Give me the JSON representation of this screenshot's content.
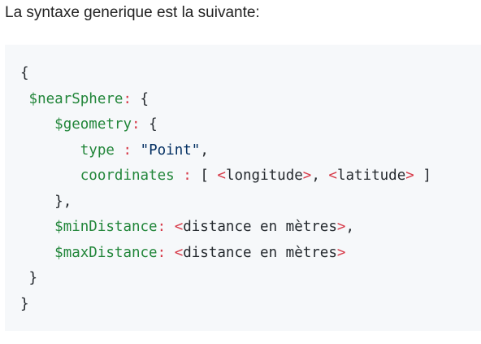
{
  "intro_text": "La syntaxe generique est la suivante:",
  "colors": {
    "key": "#22863a",
    "placeholder_bracket": "#d73a49",
    "string": "#032f62",
    "plain": "#24292e",
    "block_background": "#f6f8fa"
  },
  "code": {
    "open_brace": "{",
    "near_sphere_key": "$nearSphere",
    "geometry_key": "$geometry",
    "type_key": "type",
    "type_value": "\"Point\"",
    "coordinates_key": "coordinates",
    "longitude_placeholder": "longitude",
    "latitude_placeholder": "latitude",
    "min_distance_key": "$minDistance",
    "max_distance_key": "$maxDistance",
    "distance_placeholder": "distance en mètres",
    "close_brace": "}"
  }
}
